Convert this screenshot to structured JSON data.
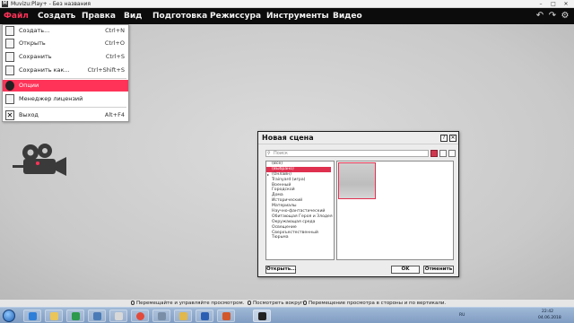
{
  "window": {
    "app_icon_letter": "M",
    "title": "Muvizu:Play+ - Без названия"
  },
  "menubar": {
    "items": [
      "Файл",
      "Создать",
      "Правка",
      "Вид",
      "Подготовка",
      "Режиссура",
      "Инструменты",
      "Видео"
    ],
    "active": "Файл",
    "tools": [
      "undo-icon",
      "redo-icon",
      "settings-icon"
    ]
  },
  "file_menu": {
    "items": [
      {
        "label": "Создать...",
        "shortcut": "Ctrl+N",
        "icon": "new-file-icon"
      },
      {
        "label": "Открыть",
        "shortcut": "Ctrl+O",
        "icon": "open-file-icon"
      },
      {
        "label": "Сохранить",
        "shortcut": "Ctrl+S",
        "icon": "save-icon"
      },
      {
        "label": "Сохранить как...",
        "shortcut": "Ctrl+Shift+S",
        "icon": "save-as-icon"
      },
      {
        "label": "Опции",
        "shortcut": "",
        "icon": "options-icon",
        "highlighted": true
      },
      {
        "label": "Менеджер лицензий",
        "shortcut": "",
        "icon": "license-lock-icon"
      },
      {
        "label": "Выход",
        "shortcut": "Alt+F4",
        "icon": "exit-icon"
      }
    ],
    "highlight_color": "#ff3358"
  },
  "dialog": {
    "title": "Новая сцена",
    "search_placeholder": "Поиск",
    "categories": [
      "(Все)",
      "(Выбрано)",
      "(Онлайн)",
      "Trainyard (игра)",
      "Военный",
      "Городской",
      "Дома",
      "Исторический",
      "Материалы",
      "Научно-фантастический",
      "Обитающая Героя и Злодея",
      "Окружающая среда",
      "Освещение",
      "Сверхъестественный",
      "Тюрьма"
    ],
    "selected_category_index": 1,
    "expandable_category_index": 2,
    "open_button": "Открыть...",
    "ok_button": "OK",
    "cancel_button": "Отменить"
  },
  "hints": [
    "Перемещайте и управляйте просмотром.",
    "Посмотреть вокруг.",
    "Перемещение просмотра в стороны и по вертикали."
  ],
  "taskbar": {
    "lang": "RU",
    "time": "22:42",
    "date": "04.06.2018",
    "apps": [
      "ie-icon",
      "explorer-icon",
      "media-player-icon",
      "control-panel-icon",
      "paint-icon",
      "chrome-icon",
      "settings-icon",
      "folder-icon",
      "word-icon",
      "powerpoint-icon",
      "muvizu-icon"
    ]
  },
  "colors": {
    "accent": "#ff3358",
    "menubar_bg": "#0c0c0c"
  }
}
